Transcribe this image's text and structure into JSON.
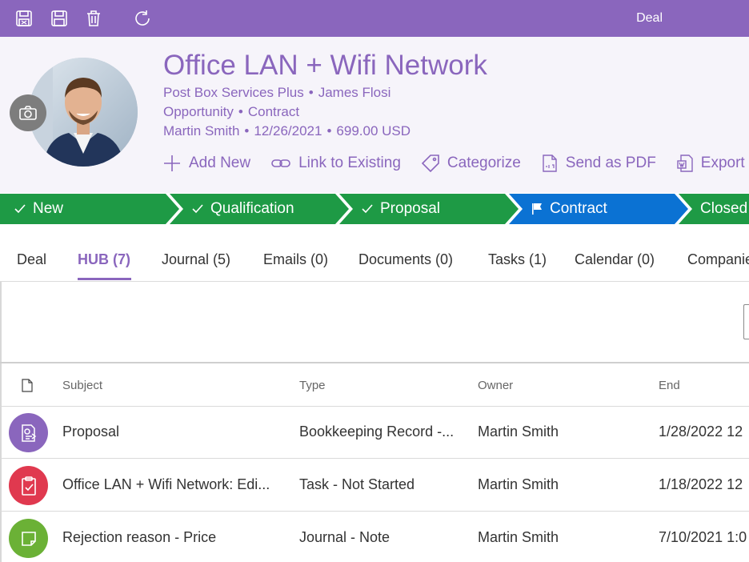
{
  "toolbar": {
    "title": "Deal",
    "icons": [
      "save-close-icon",
      "save-icon",
      "delete-icon",
      "refresh-icon"
    ],
    "color": "#8a66bd"
  },
  "deal": {
    "title": "Office LAN + Wifi Network",
    "company": "Post Box Services Plus",
    "contact": "James Flosi",
    "record_type": "Opportunity",
    "stage": "Contract",
    "owner": "Martin Smith",
    "date": "12/26/2021",
    "amount": "699.00 USD",
    "separator": "•"
  },
  "actions": [
    {
      "label": "Add New",
      "icon": "plus-icon"
    },
    {
      "label": "Link to Existing",
      "icon": "link-icon"
    },
    {
      "label": "Categorize",
      "icon": "tag-icon"
    },
    {
      "label": "Send as PDF",
      "icon": "pdf-icon"
    },
    {
      "label": "Export",
      "icon": "export-icon"
    }
  ],
  "stages": [
    {
      "label": "New",
      "state": "done",
      "color": "#1e9a45"
    },
    {
      "label": "Qualification",
      "state": "done",
      "color": "#1e9a45"
    },
    {
      "label": "Proposal",
      "state": "done",
      "color": "#1e9a45"
    },
    {
      "label": "Contract",
      "state": "current",
      "color": "#0b72d3"
    },
    {
      "label": "Closed",
      "state": "pending",
      "color": "#1e9a45"
    }
  ],
  "tabs": [
    {
      "label": "Deal"
    },
    {
      "label": "HUB (7)",
      "active": true
    },
    {
      "label": "Journal (5)"
    },
    {
      "label": "Emails (0)"
    },
    {
      "label": "Documents (0)"
    },
    {
      "label": "Tasks (1)"
    },
    {
      "label": "Calendar (0)"
    },
    {
      "label": "Companies"
    }
  ],
  "table": {
    "columns": [
      "Subject",
      "Type",
      "Owner",
      "End"
    ],
    "rows": [
      {
        "subject": "Proposal",
        "type": "Bookkeeping Record -...",
        "owner": "Martin Smith",
        "end": "1/28/2022 12",
        "icon": "bookkeeping-icon",
        "color": "#8a66bd"
      },
      {
        "subject": "Office LAN + Wifi Network: Edi...",
        "type": "Task - Not Started",
        "owner": "Martin Smith",
        "end": "1/18/2022 12",
        "icon": "task-clipboard-icon",
        "color": "#e0394f"
      },
      {
        "subject": "Rejection reason - Price",
        "type": "Journal - Note",
        "owner": "Martin Smith",
        "end": "7/10/2021 1:0",
        "icon": "note-icon",
        "color": "#6bb136"
      }
    ]
  }
}
